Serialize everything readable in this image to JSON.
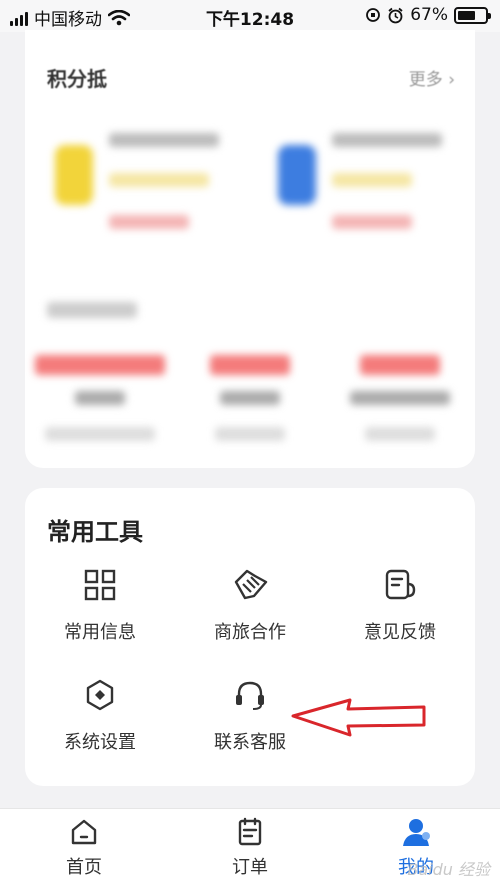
{
  "status_bar": {
    "carrier": "中国移动",
    "time": "下午12:48",
    "battery": "67%",
    "battery_level": 0.67
  },
  "points_section": {
    "title": "积分抵",
    "more": "更多 ›"
  },
  "tools_section": {
    "title": "常用工具",
    "items": [
      {
        "label": "常用信息",
        "icon": "grid-icon"
      },
      {
        "label": "商旅合作",
        "icon": "handshake-icon"
      },
      {
        "label": "意见反馈",
        "icon": "feedback-icon"
      },
      {
        "label": "系统设置",
        "icon": "settings-icon"
      },
      {
        "label": "联系客服",
        "icon": "headset-icon"
      }
    ]
  },
  "bottom_nav": {
    "items": [
      {
        "label": "首页",
        "icon": "home-icon"
      },
      {
        "label": "订单",
        "icon": "order-icon"
      },
      {
        "label": "我的",
        "icon": "profile-icon"
      }
    ]
  },
  "watermark": "Baidu 经验",
  "colors": {
    "accent": "#1e6fe0",
    "annotation_arrow": "#d9262b",
    "background": "#f2f2f4"
  }
}
